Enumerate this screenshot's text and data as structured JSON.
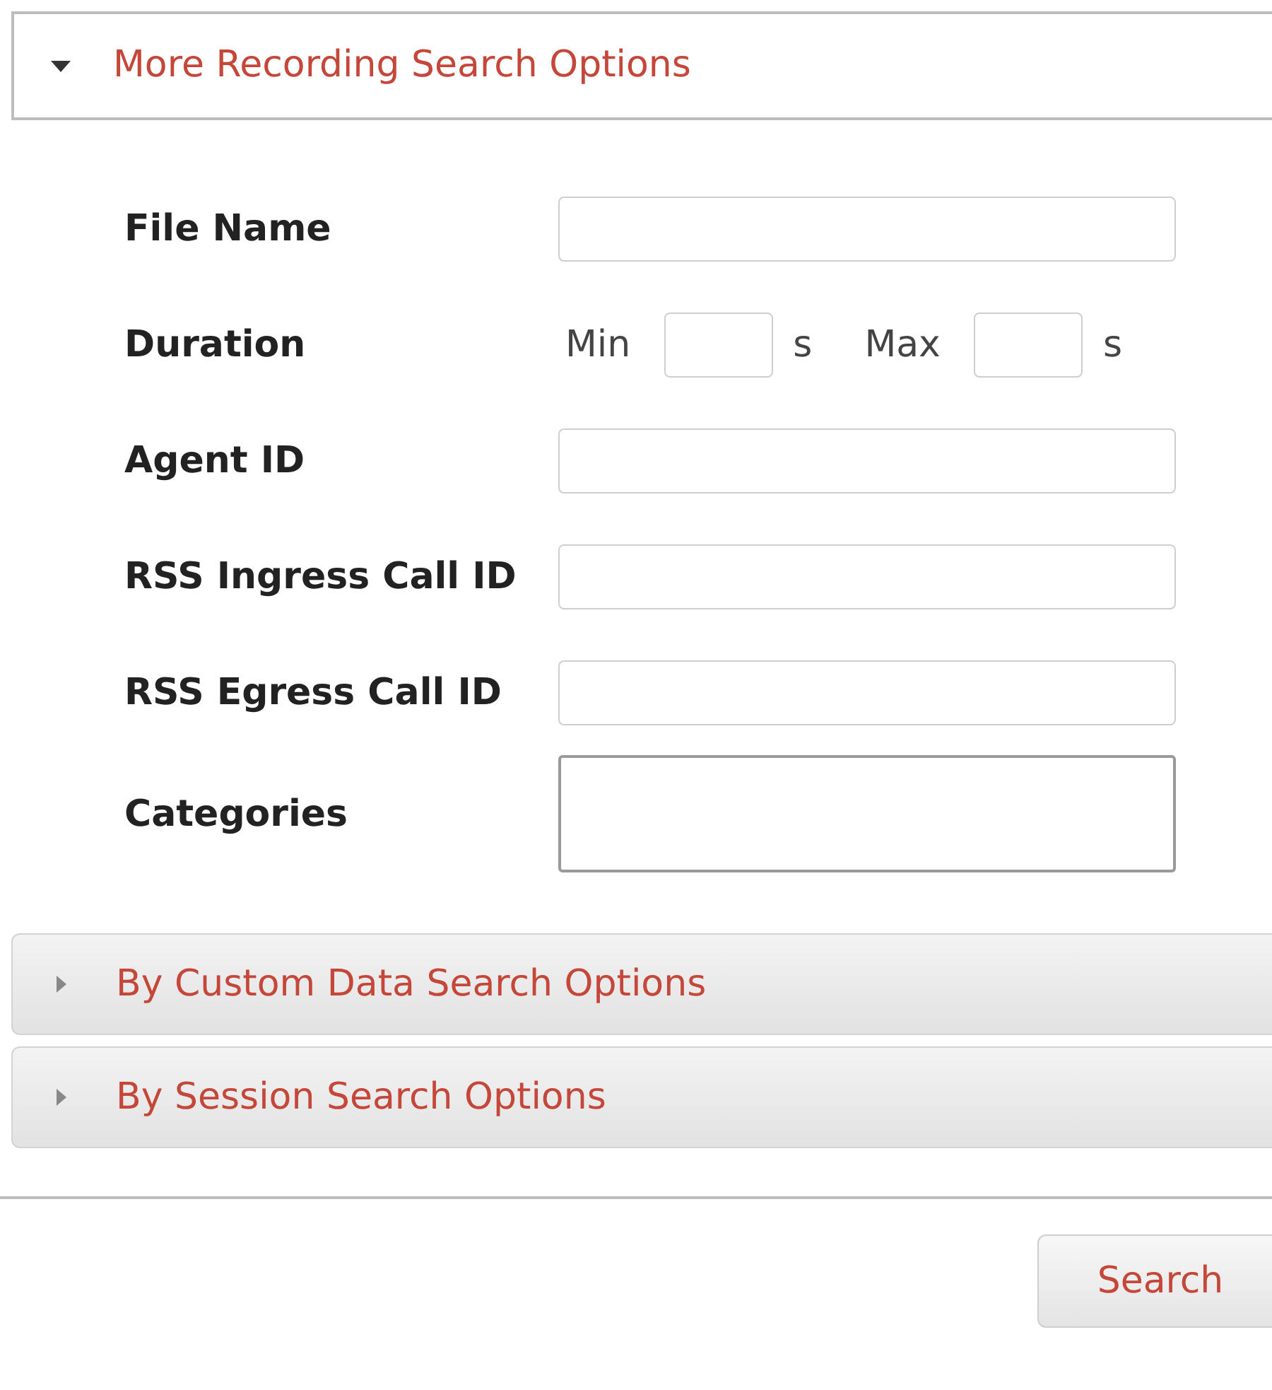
{
  "panels": [
    {
      "title": "More Recording Search Options",
      "expanded": true,
      "fields": [
        {
          "kind": "text",
          "label": "File Name"
        },
        {
          "kind": "range",
          "label": "Duration",
          "min_label": "Min",
          "max_label": "Max",
          "unit_min": "s",
          "unit_max": "s"
        },
        {
          "kind": "text",
          "label": "Agent ID"
        },
        {
          "kind": "text",
          "label": "RSS Ingress Call ID"
        },
        {
          "kind": "text",
          "label": "RSS Egress Call ID"
        },
        {
          "kind": "textarea",
          "label": "Categories"
        }
      ]
    },
    {
      "title": "By Custom Data Search Options",
      "expanded": false
    },
    {
      "title": "By Session Search Options",
      "expanded": false
    }
  ],
  "search_button": "Search"
}
